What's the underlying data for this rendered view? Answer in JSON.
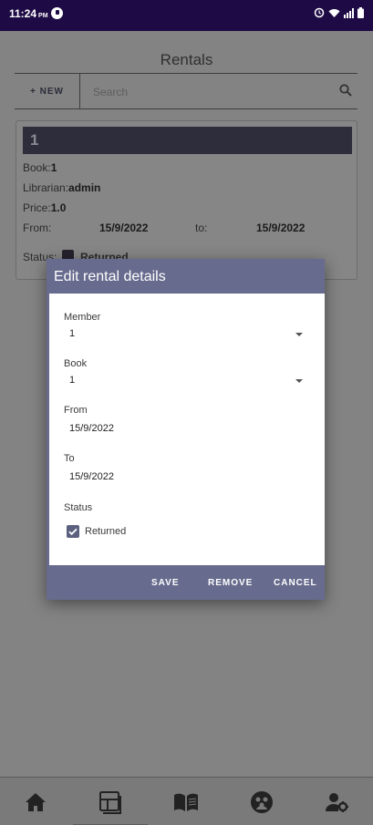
{
  "status_bar": {
    "time": "11:24",
    "ampm": "PM"
  },
  "page": {
    "title": "Rentals"
  },
  "toolbar": {
    "new_label": "+ NEW",
    "search_placeholder": "Search"
  },
  "rental_card": {
    "id": "1",
    "book_label": "Book:",
    "book_value": "1",
    "librarian_label": "Librarian:",
    "librarian_value": "admin",
    "price_label": "Price:",
    "price_value": "1.0",
    "from_label": "From:",
    "from_value": "15/9/2022",
    "to_label": "to:",
    "to_value": "15/9/2022",
    "status_label": "Status:",
    "status_value": "Returned"
  },
  "dialog": {
    "title": "Edit rental details",
    "member_label": "Member",
    "member_value": "1",
    "book_label": "Book",
    "book_value": "1",
    "from_label": "From",
    "from_value": "15/9/2022",
    "to_label": "To",
    "to_value": "15/9/2022",
    "status_label": "Status",
    "status_checkbox_label": "Returned",
    "save_label": "SAVE",
    "remove_label": "REMOVE",
    "cancel_label": "CANCEL"
  },
  "icons": {
    "nav": [
      "home-icon",
      "dashboard-icon",
      "book-icon",
      "members-icon",
      "admin-settings-icon"
    ]
  },
  "colors": {
    "status_bar": "#1e0b45",
    "accent": "#676b8d",
    "card_header": "#2e2d3c"
  }
}
